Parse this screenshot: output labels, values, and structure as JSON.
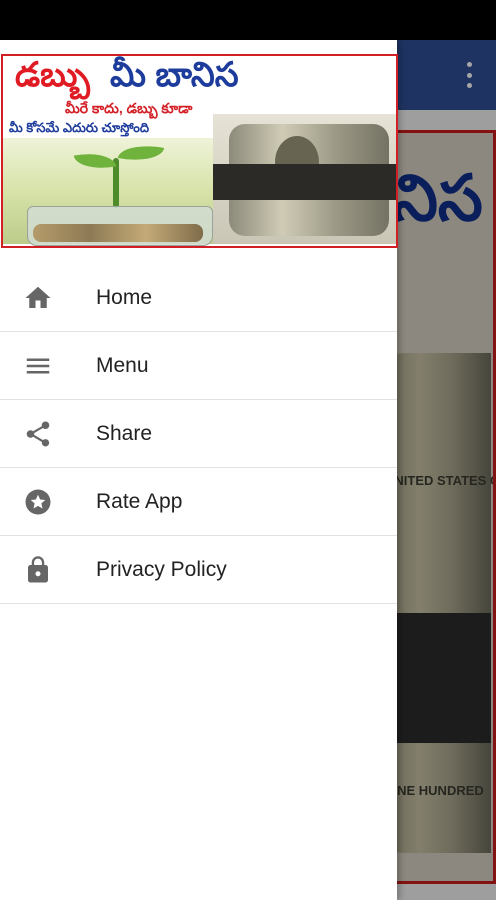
{
  "drawer": {
    "banner": {
      "title": "డబ్బు",
      "title_accent": "మీ బానిస",
      "line1": "మీరే కాదు, డబ్బు కూడా",
      "line2": "మీ కోసమే ఎదురు చూస్తోంది"
    },
    "menu": [
      {
        "label": "Home",
        "icon": "home-icon"
      },
      {
        "label": "Menu",
        "icon": "menu-icon"
      },
      {
        "label": "Share",
        "icon": "share-icon"
      },
      {
        "label": "Rate App",
        "icon": "star-icon"
      },
      {
        "label": "Privacy Policy",
        "icon": "lock-icon"
      }
    ]
  },
  "background": {
    "title_fragment": "నిస",
    "money_top_text": "UNITED STATES OF AMERICA",
    "money_bottom_text": "ONE HUNDRED"
  },
  "colors": {
    "app_bar": "#2f4f95",
    "banner_red": "#e01b24",
    "banner_blue": "#1d3c9c",
    "icon_gray": "#666666"
  }
}
